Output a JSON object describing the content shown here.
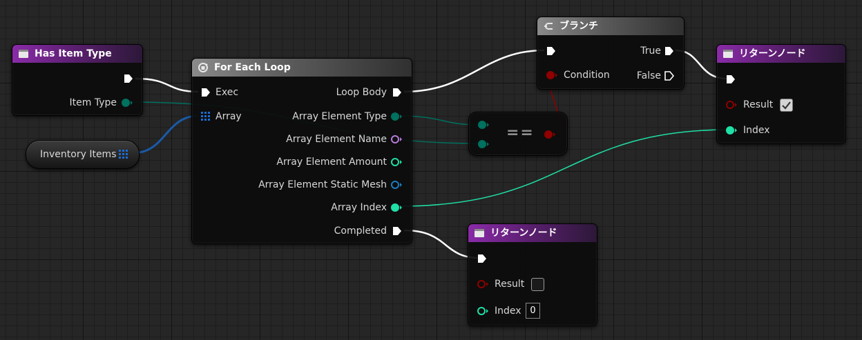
{
  "has_item_type_node": {
    "title": "Has Item Type",
    "output_label": "Item Type"
  },
  "inventory_items_node": {
    "label": "Inventory Items"
  },
  "for_each_node": {
    "title": "For Each Loop",
    "inputs": [
      "Exec",
      "Array"
    ],
    "outputs": [
      "Loop Body",
      "Array Element Type",
      "Array Element Name",
      "Array Element Amount",
      "Array Element Static Mesh",
      "Array Index",
      "Completed"
    ]
  },
  "branch_node": {
    "title": "ブランチ",
    "condition_label": "Condition",
    "true_label": "True",
    "false_label": "False"
  },
  "equal_node": {
    "symbol": "=="
  },
  "return_node_top": {
    "title": "リターンノード",
    "result_label": "Result",
    "result_value": true,
    "index_label": "Index"
  },
  "return_node_bottom": {
    "title": "リターンノード",
    "result_label": "Result",
    "result_value": false,
    "index_label": "Index",
    "index_value": "0"
  },
  "colors": {
    "exec": "#ffffff",
    "byte_enum": "#00705f",
    "name": "#b77cdc",
    "integer": "#1fe0a6",
    "struct_ref": "#1a5aa8",
    "boolean": "#8f0000",
    "mesh_ref": "#1d7cc1",
    "array": "#1a6dd6",
    "function_header": "#7a2096"
  }
}
